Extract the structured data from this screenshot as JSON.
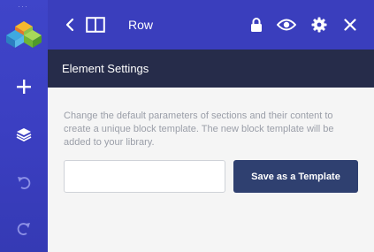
{
  "sidebar": {
    "logo": "brand-cube-logo",
    "items": [
      {
        "icon": "plus-icon"
      },
      {
        "icon": "layers-icon"
      },
      {
        "icon": "undo-icon"
      },
      {
        "icon": "redo-icon"
      }
    ]
  },
  "topbar": {
    "back_icon": "chevron-left-icon",
    "layout_icon": "panel-layout-icon",
    "title": "Row",
    "lock_icon": "lock-icon",
    "preview_icon": "eye-icon",
    "settings_icon": "gear-icon",
    "close_icon": "close-icon"
  },
  "panel": {
    "title": "Element Settings",
    "description": "Change the default parameters of sections and their content to create a unique block template. The new block template will be added to your library.",
    "template_name_value": "",
    "template_name_placeholder": "",
    "save_label": "Save as a Template"
  },
  "colors": {
    "sidebar": "#3b3fc2",
    "topbar": "#3a3ebd",
    "header": "#262c4a",
    "button": "#2f4070",
    "background": "#f5f5f5"
  }
}
